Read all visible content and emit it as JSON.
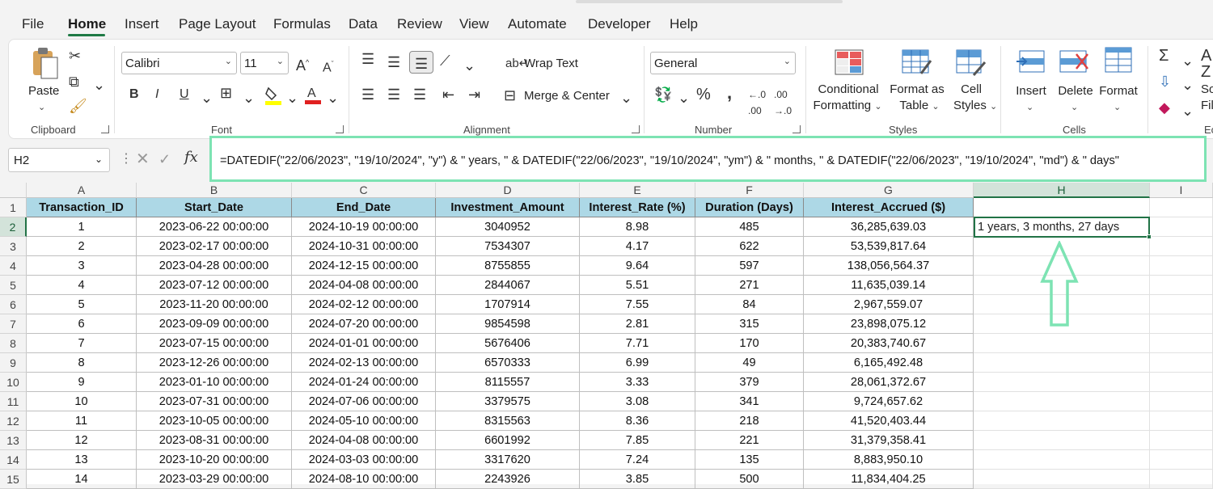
{
  "menu": {
    "items": [
      "File",
      "Home",
      "Insert",
      "Page Layout",
      "Formulas",
      "Data",
      "Review",
      "View",
      "Automate",
      "Developer",
      "Help"
    ],
    "active": "Home"
  },
  "ribbon": {
    "clipboard": {
      "paste": "Paste",
      "label": "Clipboard"
    },
    "font": {
      "name": "Calibri",
      "size": "11",
      "label": "Font"
    },
    "alignment": {
      "wrap_text": "Wrap Text",
      "merge_center": "Merge & Center",
      "label": "Alignment"
    },
    "number": {
      "format": "General",
      "label": "Number"
    },
    "styles": {
      "conditional": [
        "Conditional",
        "Formatting"
      ],
      "format_table": [
        "Format as",
        "Table"
      ],
      "cell_styles": [
        "Cell",
        "Styles"
      ],
      "label": "Styles"
    },
    "cells": {
      "insert": "Insert",
      "delete": "Delete",
      "format": "Format",
      "label": "Cells"
    },
    "editing": {
      "sort_partial": [
        "So",
        "Filt"
      ],
      "label_partial": "Ec"
    }
  },
  "formula_bar": {
    "name_box": "H2",
    "formula": "=DATEDIF(\"22/06/2023\", \"19/10/2024\", \"y\") & \" years, \" & DATEDIF(\"22/06/2023\", \"19/10/2024\", \"ym\") & \" months, \" & DATEDIF(\"22/06/2023\", \"19/10/2024\", \"md\") & \" days\""
  },
  "sheet": {
    "column_letters": [
      "A",
      "B",
      "C",
      "D",
      "E",
      "F",
      "G",
      "H",
      "I"
    ],
    "selected_column": "H",
    "selected_row": "2",
    "headers": [
      "Transaction_ID",
      "Start_Date",
      "End_Date",
      "Investment_Amount",
      "Interest_Rate (%)",
      "Duration (Days)",
      "Interest_Accrued ($)"
    ],
    "rows": [
      [
        "1",
        "2023-06-22 00:00:00",
        "2024-10-19 00:00:00",
        "3040952",
        "8.98",
        "485",
        "36,285,639.03"
      ],
      [
        "2",
        "2023-02-17 00:00:00",
        "2024-10-31 00:00:00",
        "7534307",
        "4.17",
        "622",
        "53,539,817.64"
      ],
      [
        "3",
        "2023-04-28 00:00:00",
        "2024-12-15 00:00:00",
        "8755855",
        "9.64",
        "597",
        "138,056,564.37"
      ],
      [
        "4",
        "2023-07-12 00:00:00",
        "2024-04-08 00:00:00",
        "2844067",
        "5.51",
        "271",
        "11,635,039.14"
      ],
      [
        "5",
        "2023-11-20 00:00:00",
        "2024-02-12 00:00:00",
        "1707914",
        "7.55",
        "84",
        "2,967,559.07"
      ],
      [
        "6",
        "2023-09-09 00:00:00",
        "2024-07-20 00:00:00",
        "9854598",
        "2.81",
        "315",
        "23,898,075.12"
      ],
      [
        "7",
        "2023-07-15 00:00:00",
        "2024-01-01 00:00:00",
        "5676406",
        "7.71",
        "170",
        "20,383,740.67"
      ],
      [
        "8",
        "2023-12-26 00:00:00",
        "2024-02-13 00:00:00",
        "6570333",
        "6.99",
        "49",
        "6,165,492.48"
      ],
      [
        "9",
        "2023-01-10 00:00:00",
        "2024-01-24 00:00:00",
        "8115557",
        "3.33",
        "379",
        "28,061,372.67"
      ],
      [
        "10",
        "2023-07-31 00:00:00",
        "2024-07-06 00:00:00",
        "3379575",
        "3.08",
        "341",
        "9,724,657.62"
      ],
      [
        "11",
        "2023-10-05 00:00:00",
        "2024-05-10 00:00:00",
        "8315563",
        "8.36",
        "218",
        "41,520,403.44"
      ],
      [
        "12",
        "2023-08-31 00:00:00",
        "2024-04-08 00:00:00",
        "6601992",
        "7.85",
        "221",
        "31,379,358.41"
      ],
      [
        "13",
        "2023-10-20 00:00:00",
        "2024-03-03 00:00:00",
        "3317620",
        "7.24",
        "135",
        "8,883,950.10"
      ],
      [
        "14",
        "2023-03-29 00:00:00",
        "2024-08-10 00:00:00",
        "2243926",
        "3.85",
        "500",
        "11,834,404.25"
      ]
    ],
    "h2_value": "1 years, 3 months, 27 days"
  },
  "colors": {
    "accent_green": "#217346",
    "highlight": "#7de3b3",
    "header_fill": "#add8e6"
  }
}
